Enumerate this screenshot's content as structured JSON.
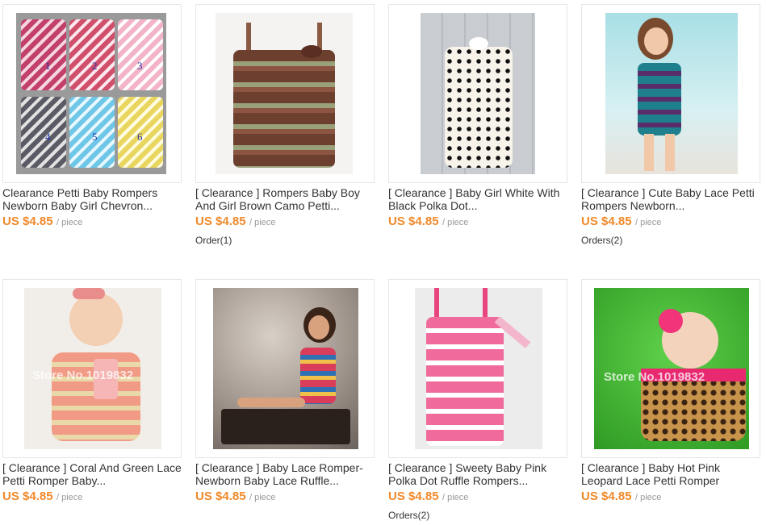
{
  "products": [
    {
      "title": "Clearance Petti Baby Rompers Newborn Baby Girl Chevron...",
      "price": "US $4.85",
      "unit": "/ piece",
      "orders": "",
      "image": "six-chevron-petti-rompers-image",
      "labels": [
        "1",
        "2",
        "3",
        "4",
        "5",
        "6"
      ]
    },
    {
      "title": "[ Clearance ] Rompers Baby Boy And Girl Brown Camo Petti...",
      "price": "US $4.85",
      "unit": "/ piece",
      "orders": "Order(1)",
      "image": "brown-camo-romper-image"
    },
    {
      "title": "[ Clearance ] Baby Girl White With Black Polka Dot...",
      "price": "US $4.85",
      "unit": "/ piece",
      "orders": "",
      "image": "white-polka-dot-romper-image"
    },
    {
      "title": "[ Clearance ] Cute Baby Lace Petti Rompers Newborn...",
      "price": "US $4.85",
      "unit": "/ piece",
      "orders": "Orders(2)",
      "image": "girl-teal-romper-image"
    },
    {
      "title": "[ Clearance ] Coral And Green Lace Petti Romper Baby...",
      "price": "US $4.85",
      "unit": "/ piece",
      "orders": "",
      "image": "baby-coral-romper-image",
      "watermark": "Store No.1019832"
    },
    {
      "title": "[ Clearance ] Baby Lace Romper- Newborn Baby Lace Ruffle...",
      "price": "US $4.85",
      "unit": "/ piece",
      "orders": "",
      "image": "girl-sitting-on-trunk-image"
    },
    {
      "title": "[ Clearance ] Sweety Baby Pink Polka Dot Ruffle Rompers...",
      "price": "US $4.85",
      "unit": "/ piece",
      "orders": "Orders(2)",
      "image": "pink-polka-dot-romper-image"
    },
    {
      "title": "[ Clearance ] Baby Hot Pink Leopard Lace Petti Romper",
      "price": "US $4.85",
      "unit": "/ piece",
      "orders": "",
      "image": "baby-leopard-romper-image",
      "watermark": "Store No.1019832"
    }
  ],
  "colors": {
    "price": "#f0892a",
    "title": "#333333",
    "unit": "#999999",
    "border": "#e6e6e6"
  }
}
